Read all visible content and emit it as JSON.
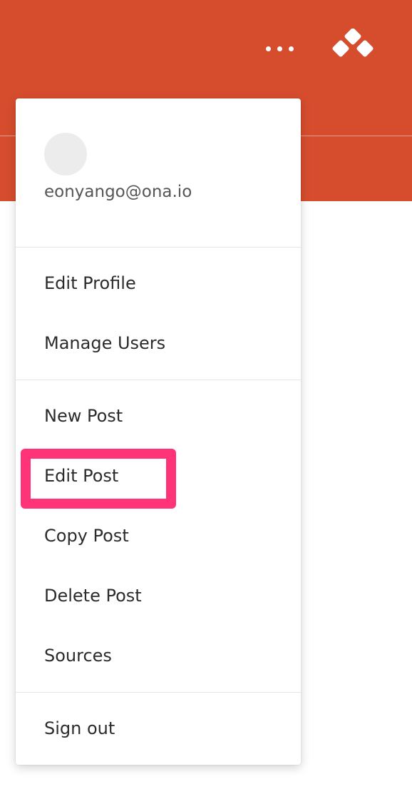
{
  "header": {
    "background_color": "#d64d2e",
    "more_icon": "more-horizontal-icon",
    "logo_icon": "logo-diamonds-icon"
  },
  "user_menu": {
    "email": "eonyango@ona.io",
    "profile_items": [
      {
        "label": "Edit Profile"
      },
      {
        "label": "Manage Users"
      }
    ],
    "post_items": [
      {
        "label": "New Post"
      },
      {
        "label": "Edit Post",
        "highlighted": true
      },
      {
        "label": "Copy Post"
      },
      {
        "label": "Delete Post"
      },
      {
        "label": "Sources"
      }
    ],
    "sign_out_label": "Sign out"
  },
  "highlight_color": "#ff3377"
}
